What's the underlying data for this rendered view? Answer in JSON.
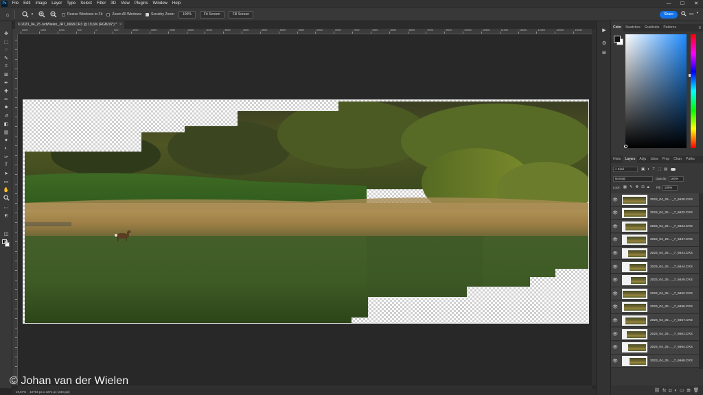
{
  "app": {
    "logo": "Ps",
    "menu": [
      "File",
      "Edit",
      "Image",
      "Layer",
      "Type",
      "Select",
      "Filter",
      "3D",
      "View",
      "Plugins",
      "Window",
      "Help"
    ],
    "window_controls": [
      "—",
      "☐",
      "✕"
    ]
  },
  "options_bar": {
    "resize_windows_label": "Resize Windows to Fit",
    "zoom_all_label": "Zoom All Windows",
    "scrubby_zoom_label": "Scrubby Zoom",
    "scrubby_zoom_checked": true,
    "zoom_100_label": "100%",
    "fit_screen_label": "Fit Screen",
    "fill_screen_label": "Fill Screen",
    "share_label": "Share"
  },
  "document": {
    "tab_title": "© 2023_04_25 JvdWielen_JR7_6668.CR3 @ 19,6% (RGB/16*) *",
    "tab_close": "×"
  },
  "ruler": {
    "labels": [
      "2000",
      "1500",
      "1000",
      "500",
      "0",
      "500",
      "1000",
      "1500",
      "2000",
      "2500",
      "3000",
      "3500",
      "4000",
      "4500",
      "5000",
      "5500",
      "6000",
      "6500",
      "7000",
      "7500",
      "8000",
      "8500",
      "9000",
      "9500",
      "10000",
      "10500",
      "11000",
      "11500",
      "12000",
      "12500",
      "13000"
    ]
  },
  "status_bar": {
    "zoom": "19,67%",
    "doc_size": "10784 px x 4271 px (240 ppi)"
  },
  "panels": {
    "color_tabs": [
      "Color",
      "Swatches",
      "Gradients",
      "Patterns"
    ],
    "layer_tabs": [
      "Histo",
      "Layers",
      "Adju",
      "Libra",
      "Prop",
      "Chan",
      "Paths"
    ],
    "kind_label": "Kind",
    "blend_mode": "Normal",
    "opacity_label": "Opacity:",
    "opacity_value": "100%",
    "lock_label": "Lock:",
    "fill_label": "Fill:",
    "fill_value": "100%"
  },
  "layers": [
    {
      "name": "2023_04_25 ..._7_6630.CR3"
    },
    {
      "name": "2023_04_25 ..._7_6632.CR3"
    },
    {
      "name": "2023_04_25 ..._7_6634.CR3"
    },
    {
      "name": "2023_04_25 ..._7_6637.CR3"
    },
    {
      "name": "2023_04_25 ..._7_6641.CR3"
    },
    {
      "name": "2023_04_25 ..._7_6644.CR3"
    },
    {
      "name": "2023_04_25 ..._7_6649.CR3"
    },
    {
      "name": "2023_04_25 ..._7_6652.CR3"
    },
    {
      "name": "2023_04_25 ..._7_6655.CR3"
    },
    {
      "name": "2023_04_25 ..._7_6657.CR3"
    },
    {
      "name": "2023_04_25 ..._7_6661.CR3"
    },
    {
      "name": "2023_04_25 ..._7_6664.CR3"
    },
    {
      "name": "2023_04_25 ..._7_6668.CR3"
    }
  ],
  "watermark": "© Johan van der Wielen"
}
